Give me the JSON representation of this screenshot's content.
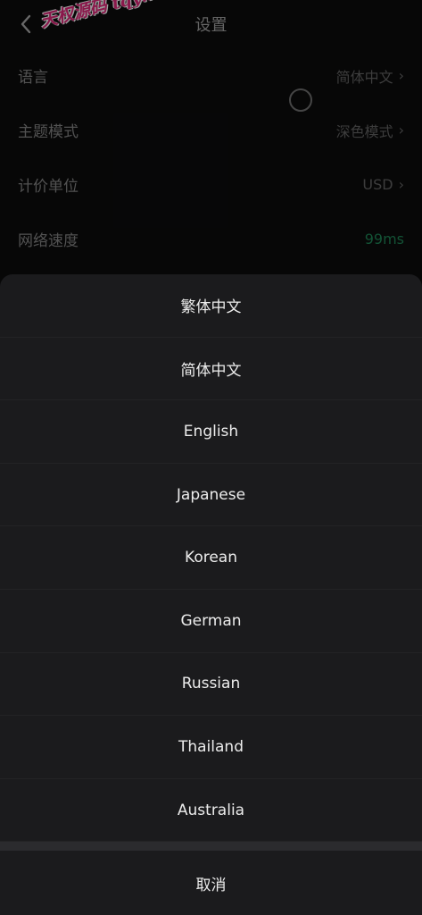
{
  "header": {
    "title": "设置",
    "watermark": "天权源码 tqym",
    "back_icon": "chevron-left-icon"
  },
  "settings": [
    {
      "label": "语言",
      "value": "简体中文",
      "chevron": true
    },
    {
      "label": "主题模式",
      "value": "深色模式",
      "chevron": true
    },
    {
      "label": "计价单位",
      "value": "USD",
      "chevron": true
    },
    {
      "label": "网络速度",
      "value": "99ms",
      "chevron": false
    }
  ],
  "language_sheet": {
    "options": [
      "繁体中文",
      "简体中文",
      "English",
      "Japanese",
      "Korean",
      "German",
      "Russian",
      "Thailand",
      "Australia"
    ],
    "cancel_label": "取消"
  },
  "colors": {
    "background": "#0b0b0c",
    "sheet": "#1b1b1d",
    "speed_green": "#1e7f52",
    "watermark": "#e0287a"
  }
}
